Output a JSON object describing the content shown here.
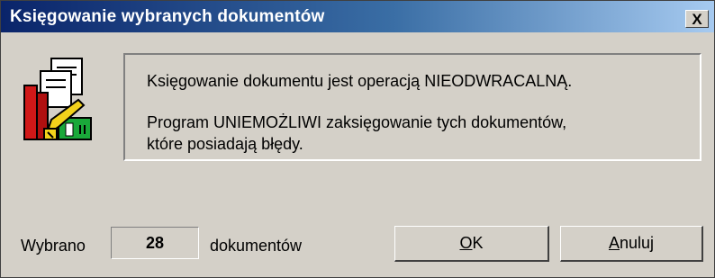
{
  "window": {
    "title": "Księgowanie wybranych dokumentów",
    "close_glyph": "X"
  },
  "icon": "books-ledger-icon",
  "message": {
    "line1": "Księgowanie dokumentu jest operacją NIEODWRACALNĄ.",
    "line2": "Program UNIEMOŻLIWI zaksięgowanie tych dokumentów,",
    "line3": "które posiadają błędy."
  },
  "footer": {
    "selected_label": "Wybrano",
    "selected_count": "28",
    "selected_suffix": "dokumentów"
  },
  "buttons": {
    "ok_mnemonic": "O",
    "ok_rest": "K",
    "cancel_mnemonic": "A",
    "cancel_rest": "nuluj"
  },
  "colors": {
    "titlebar_start": "#0a246a",
    "titlebar_end": "#a6caf0",
    "face": "#d4d0c8"
  }
}
